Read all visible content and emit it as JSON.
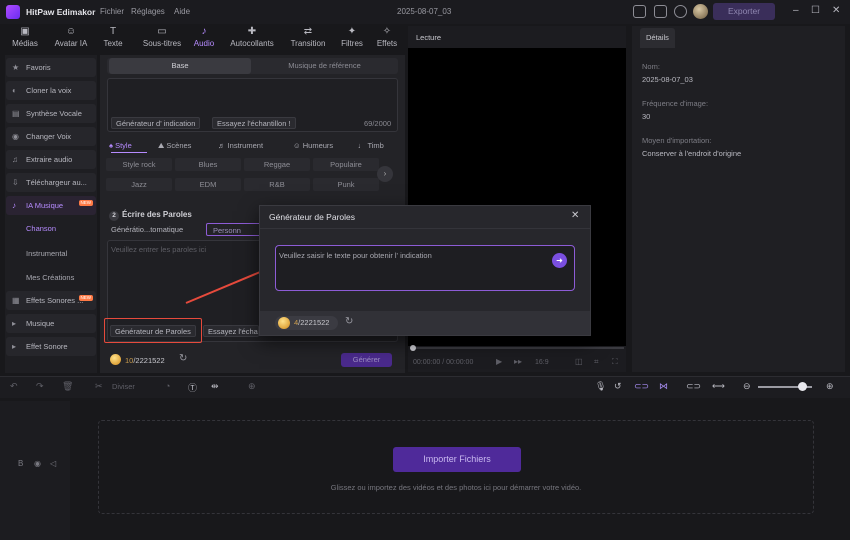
{
  "titlebar": {
    "app_name": "HitPaw Edimakor",
    "menu": [
      "Fichier",
      "Réglages",
      "Aide"
    ],
    "project_title": "2025-08-07_03",
    "export_label": "Exporter"
  },
  "toolbar": {
    "tabs": [
      {
        "label": "Médias",
        "icon": "media-icon"
      },
      {
        "label": "Avatar IA",
        "icon": "avatar-ai-icon"
      },
      {
        "label": "Texte",
        "icon": "text-icon"
      },
      {
        "label": "Sous-titres",
        "icon": "subtitles-icon"
      },
      {
        "label": "Audio",
        "icon": "audio-icon"
      },
      {
        "label": "Autocollants",
        "icon": "stickers-icon"
      },
      {
        "label": "Transition",
        "icon": "transition-icon"
      },
      {
        "label": "Filtres",
        "icon": "filters-icon"
      },
      {
        "label": "Effets",
        "icon": "effects-icon"
      }
    ],
    "active_index": 4
  },
  "sidebar": {
    "items": [
      {
        "label": "Favoris"
      },
      {
        "label": "Cloner la voix"
      },
      {
        "label": "Synthèse Vocale"
      },
      {
        "label": "Changer Voix"
      },
      {
        "label": "Extraire audio"
      },
      {
        "label": "Téléchargeur au..."
      },
      {
        "label": "IA Musique",
        "badge": "NEW"
      },
      {
        "label": "Effets Sonores ...",
        "badge": "NEW"
      },
      {
        "label": "Musique"
      },
      {
        "label": "Effet Sonore"
      }
    ],
    "sub_items": [
      "Chanson",
      "Instrumental",
      "Mes Créations"
    ]
  },
  "music_panel": {
    "segments": [
      "Base",
      "Musique de référence"
    ],
    "prompt_chips": [
      "Générateur d' indication",
      "Essayez l'échantillon !"
    ],
    "prompt_counter": "69/2000",
    "categories": [
      "Style",
      "Scènes",
      "Instrument",
      "Humeurs",
      "Timb"
    ],
    "styles_row1": [
      "Style rock",
      "Blues",
      "Reggae",
      "Populaire"
    ],
    "styles_row2": [
      "Jazz",
      "EDM",
      "R&B",
      "Punk"
    ],
    "lyrics_title": "Écrire des Paroles",
    "lyrics_step": "2",
    "lyrics_modes": [
      "Générátio...tomatique",
      "Personn"
    ],
    "lyrics_placeholder": "Veuillez entrer les paroles ici",
    "lyrics_chips": [
      "Générateur de Paroles",
      "Essayez l'échan"
    ],
    "credits_used": "10",
    "credits_total": "/2221522",
    "generate_label": "Générer"
  },
  "preview": {
    "header": "Lecture",
    "time": "00:00:00 / 00:00:00",
    "ratio": "16:9"
  },
  "details": {
    "tab": "Détails",
    "fields": [
      {
        "label": "Nom:",
        "value": "2025-08-07_03"
      },
      {
        "label": "Fréquence d'image:",
        "value": "30"
      },
      {
        "label": "Moyen d'importation:",
        "value": "Conserver à l'endroit d'origine"
      }
    ]
  },
  "timeline": {
    "split_label": "Diviser",
    "import_label": "Importer Fichiers",
    "drop_hint": "Glissez ou importez des vidéos et des photos ici pour démarrer votre vidéo.",
    "zoom_level": 0.82
  },
  "modal": {
    "title": "Générateur de Paroles",
    "input_placeholder": "Veuillez saisir le texte pour obtenir l'  indication",
    "credits_used": "4",
    "credits_total": "/2221522"
  },
  "colors": {
    "accent": "#b68bff",
    "primary_button": "#4f2a9a",
    "highlight": "#e64a3c"
  }
}
